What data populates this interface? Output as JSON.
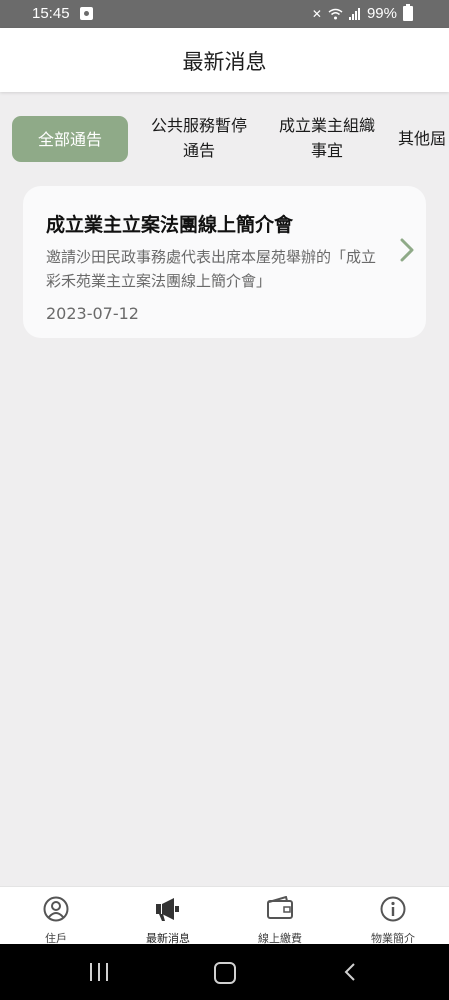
{
  "status_bar": {
    "time": "15:45",
    "battery": "99%"
  },
  "header": {
    "title": "最新消息"
  },
  "tabs": [
    {
      "label": "全部通告",
      "active": true
    },
    {
      "label": "公共服務暫停\n通告",
      "active": false
    },
    {
      "label": "成立業主組織\n事宜",
      "active": false
    },
    {
      "label": "其他屆",
      "active": false
    }
  ],
  "news": [
    {
      "title": "成立業主立案法團線上簡介會",
      "description": "邀請沙田民政事務處代表出席本屋苑舉辦的「成立彩禾苑業主立案法團線上簡介會」",
      "date": "2023-07-12"
    }
  ],
  "bottom_nav": [
    {
      "label": "住戶",
      "icon": "person-icon"
    },
    {
      "label": "最新消息",
      "icon": "megaphone-icon",
      "active": true
    },
    {
      "label": "線上繳費",
      "icon": "wallet-icon"
    },
    {
      "label": "物業簡介",
      "icon": "info-icon"
    }
  ],
  "colors": {
    "accent": "#8faa88",
    "background": "#efeeef",
    "card": "#fafafb"
  }
}
